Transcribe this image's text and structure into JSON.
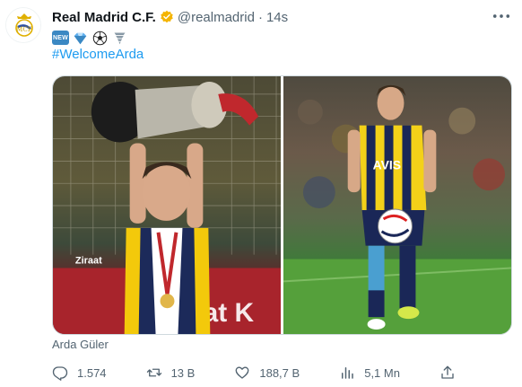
{
  "tweet": {
    "author_name": "Real Madrid C.F.",
    "handle": "@realmadrid",
    "separator": "·",
    "time": "14s",
    "more_icon": "more-icon",
    "verified_icon": "verified-badge-icon",
    "verified_color": "#f4b400",
    "emojis": [
      "new-button-emoji",
      "diamond-emoji",
      "soccer-ball-emoji",
      "tornado-emoji"
    ],
    "new_emoji_text": "NEW",
    "hashtag": "#WelcomeArda",
    "hashtag_color": "#1d9bf0",
    "media": [
      {
        "label": "photo-trophy-celebration"
      },
      {
        "label": "photo-player-with-ball"
      }
    ],
    "caption": "Arda Güler",
    "actions": {
      "reply": {
        "icon": "reply-icon",
        "count": "1.574"
      },
      "retweet": {
        "icon": "retweet-icon",
        "count": "13 B"
      },
      "like": {
        "icon": "heart-icon",
        "count": "188,7 B"
      },
      "views": {
        "icon": "views-icon",
        "count": "5,1 Mn"
      },
      "share": {
        "icon": "share-icon"
      }
    }
  }
}
